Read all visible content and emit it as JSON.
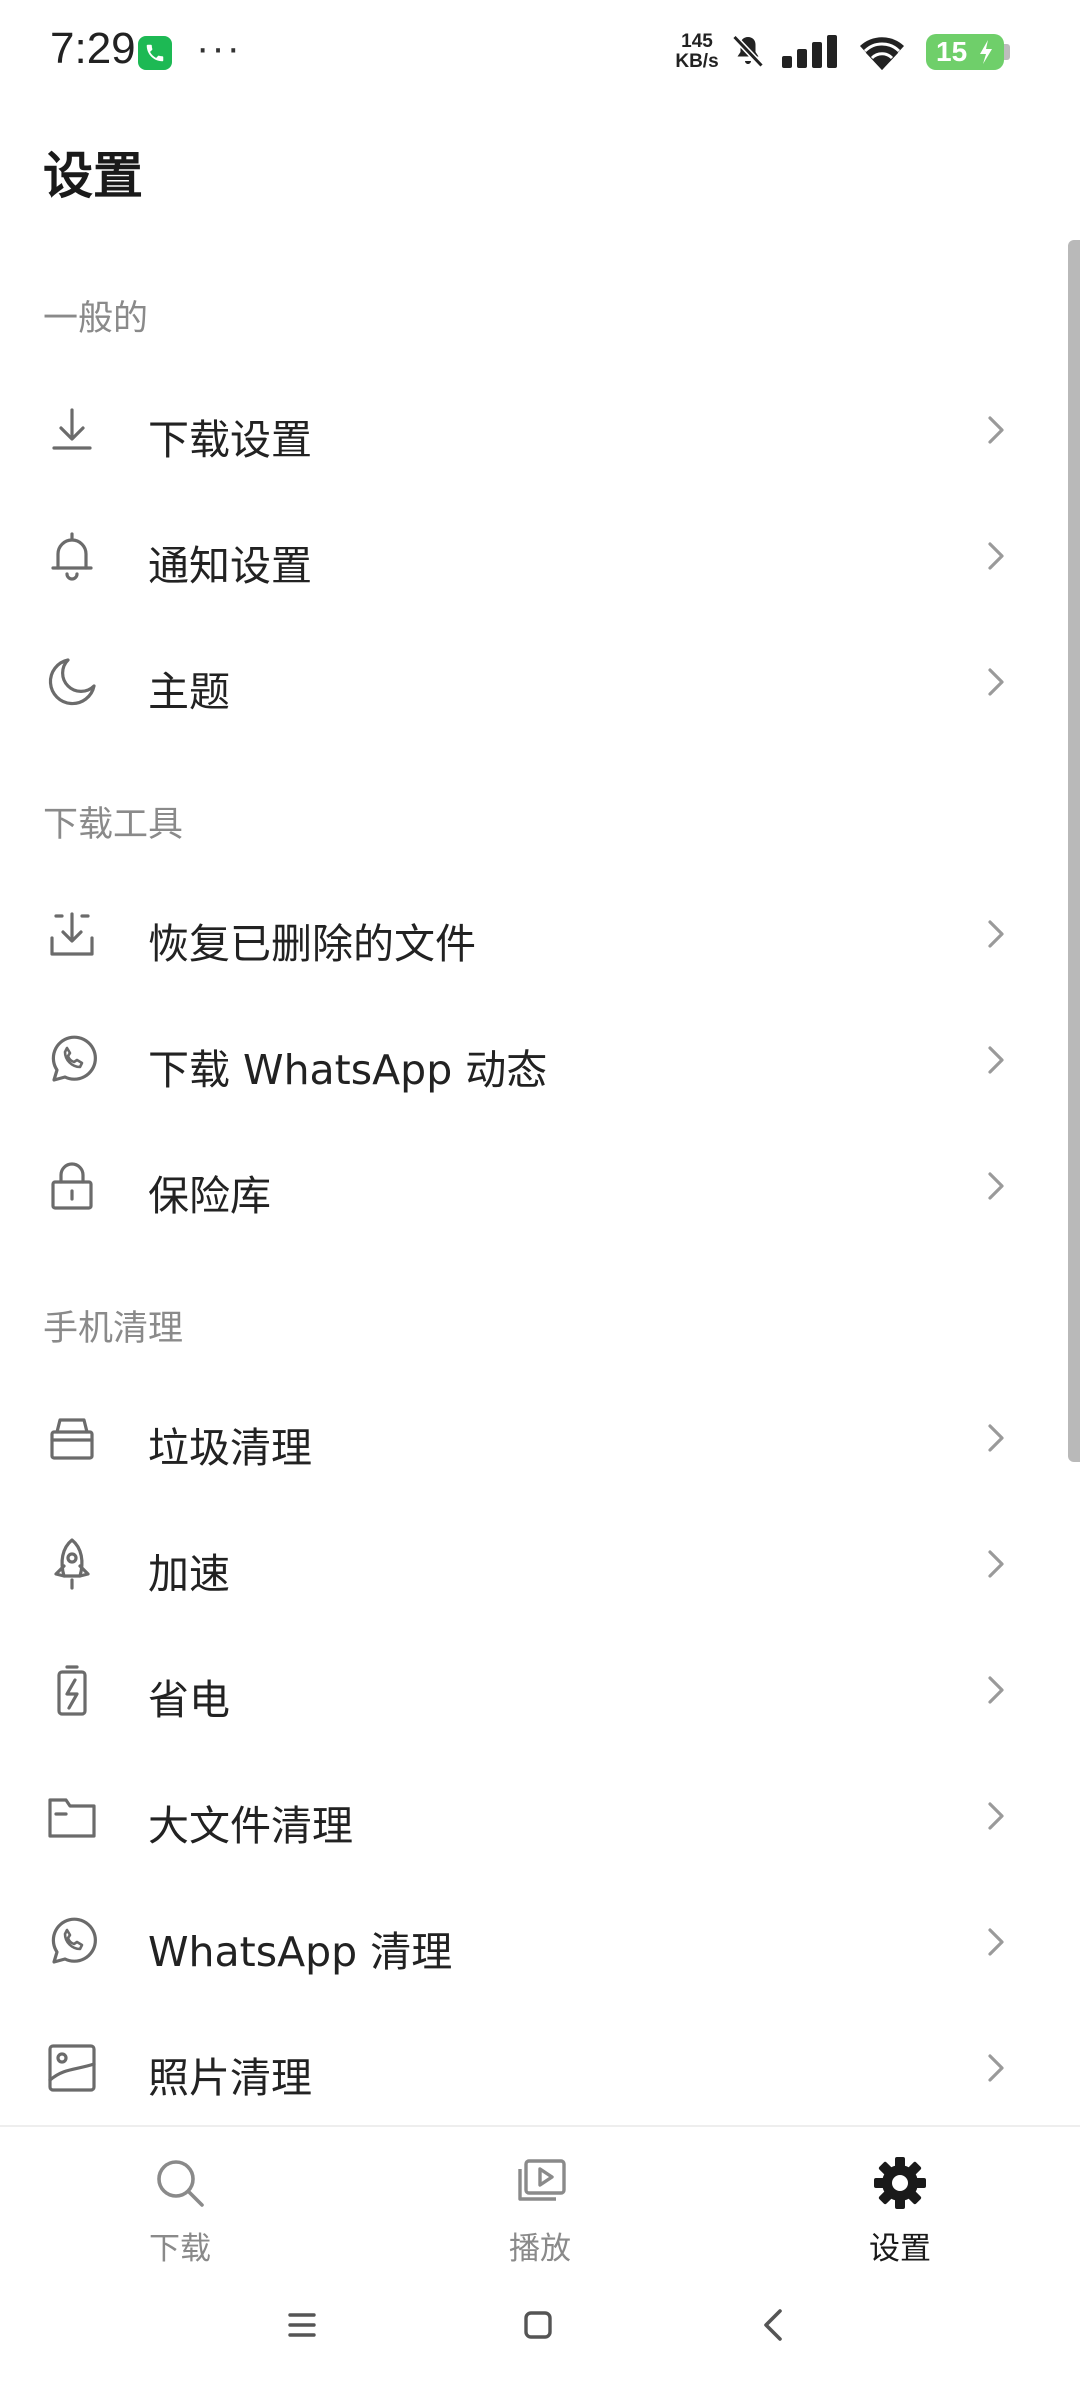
{
  "status_bar": {
    "time": "7:29",
    "dots": "···",
    "net_speed_value": "145",
    "net_speed_unit": "KB/s",
    "battery_level": "15",
    "icons": [
      "call-icon",
      "mute-icon",
      "signal-icon",
      "wifi-icon",
      "battery-charging-icon"
    ]
  },
  "page": {
    "title": "设置"
  },
  "sections": {
    "general": {
      "header": "一般的",
      "items": [
        {
          "label": "下载设置",
          "icon": "download-icon"
        },
        {
          "label": "通知设置",
          "icon": "bell-icon"
        },
        {
          "label": "主题",
          "icon": "moon-icon"
        }
      ]
    },
    "download_tools": {
      "header": "下载工具",
      "items": [
        {
          "label": "恢复已删除的文件",
          "icon": "restore-download-icon"
        },
        {
          "label": "下载 WhatsApp 动态",
          "icon": "whatsapp-icon"
        },
        {
          "label": "保险库",
          "icon": "lock-icon"
        }
      ]
    },
    "phone_cleaning": {
      "header": "手机清理",
      "items": [
        {
          "label": "垃圾清理",
          "icon": "trash-bin-icon"
        },
        {
          "label": "加速",
          "icon": "rocket-icon"
        },
        {
          "label": "省电",
          "icon": "battery-saver-icon"
        },
        {
          "label": "大文件清理",
          "icon": "folder-icon"
        },
        {
          "label": "WhatsApp 清理",
          "icon": "whatsapp-icon"
        },
        {
          "label": "照片清理",
          "icon": "photo-icon"
        }
      ]
    }
  },
  "bottom_nav": {
    "tabs": [
      {
        "label": "下载",
        "icon": "search-icon",
        "active": false
      },
      {
        "label": "播放",
        "icon": "play-library-icon",
        "active": false
      },
      {
        "label": "设置",
        "icon": "gear-icon",
        "active": true
      }
    ]
  },
  "colors": {
    "active_tab": "#1a1a1a",
    "inactive": "#8a8a8a",
    "section_header": "#8a8a8a",
    "battery": "#6fcf6a"
  }
}
